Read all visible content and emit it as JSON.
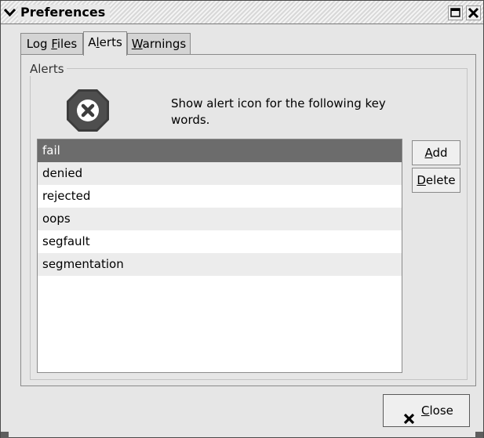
{
  "window": {
    "title": "Preferences"
  },
  "tabs": [
    {
      "before": "Log ",
      "mnemonic": "F",
      "after": "iles",
      "active": false
    },
    {
      "before": "A",
      "mnemonic": "l",
      "after": "erts",
      "active": true
    },
    {
      "before": "",
      "mnemonic": "W",
      "after": "arnings",
      "active": false
    }
  ],
  "alerts_panel": {
    "frame_label": "Alerts",
    "description": "Show alert icon for the following key words.",
    "icon": "alert-x-octagon-icon",
    "keywords": [
      {
        "text": "fail",
        "selected": true
      },
      {
        "text": "denied",
        "selected": false
      },
      {
        "text": "rejected",
        "selected": false
      },
      {
        "text": "oops",
        "selected": false
      },
      {
        "text": "segfault",
        "selected": false
      },
      {
        "text": "segmentation",
        "selected": false
      }
    ],
    "add_button": {
      "mnemonic": "A",
      "rest": "dd"
    },
    "delete_button": {
      "mnemonic": "D",
      "rest": "elete"
    }
  },
  "close_button": {
    "mnemonic": "C",
    "rest": "lose",
    "icon": "x-icon"
  },
  "colors": {
    "selection": "#6c6c6c",
    "alt_row": "#ececec",
    "window_bg": "#e6e6e6"
  }
}
